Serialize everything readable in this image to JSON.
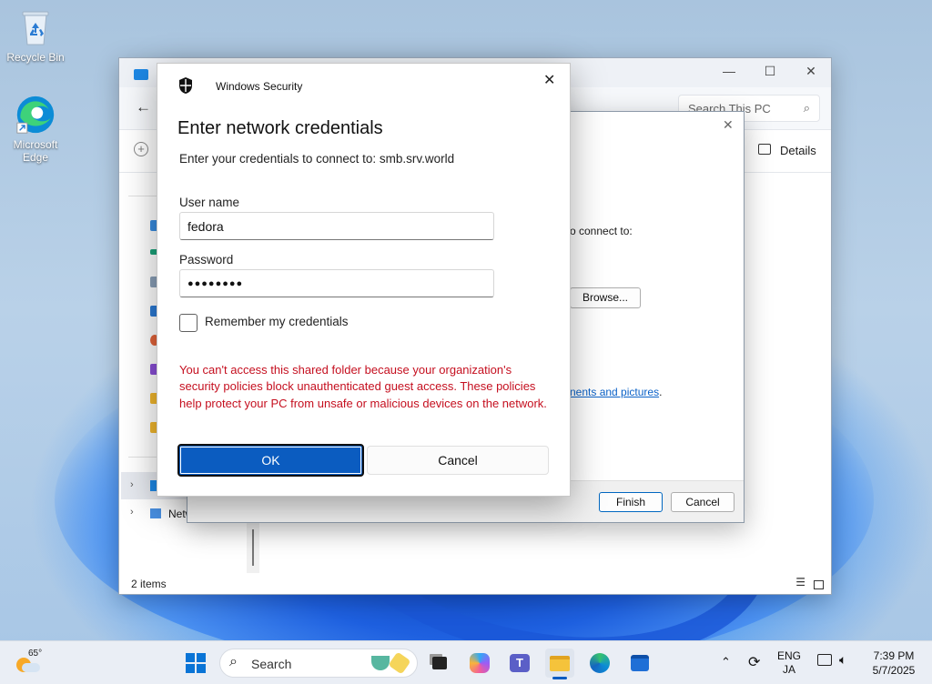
{
  "desktop": {
    "icons": [
      {
        "label": "Recycle Bin",
        "icon": "recycle-bin-icon"
      },
      {
        "label": "Microsoft Edge",
        "icon": "edge-icon"
      }
    ]
  },
  "explorer": {
    "search_placeholder": "Search This PC",
    "details_label": "Details",
    "status": "2 items",
    "nav_partial_label": "Netw"
  },
  "wizard": {
    "partial_text": "o connect to:",
    "browse_label": "Browse...",
    "link_partial": "nents and pictures",
    "link_period": ".",
    "finish_label": "Finish",
    "cancel_label": "Cancel"
  },
  "security_dialog": {
    "app_name": "Windows Security",
    "title": "Enter network credentials",
    "subtitle": "Enter your credentials to connect to: smb.srv.world",
    "username_label": "User name",
    "username_value": "fedora",
    "password_label": "Password",
    "password_value": "●●●●●●●●",
    "remember_label": "Remember my credentials",
    "remember_checked": false,
    "error_message": "You can't access this shared folder because your organization's security policies block unauthenticated guest access. These policies help protect your PC from unsafe or malicious devices on the network.",
    "ok_label": "OK",
    "cancel_label": "Cancel",
    "error_color": "#c50f1f",
    "accent_color": "#0b5cc0"
  },
  "taskbar": {
    "weather_temp": "65°",
    "search_label": "Search",
    "lang_top": "ENG",
    "lang_bottom": "JA",
    "time": "7:39 PM",
    "date": "5/7/2025"
  }
}
